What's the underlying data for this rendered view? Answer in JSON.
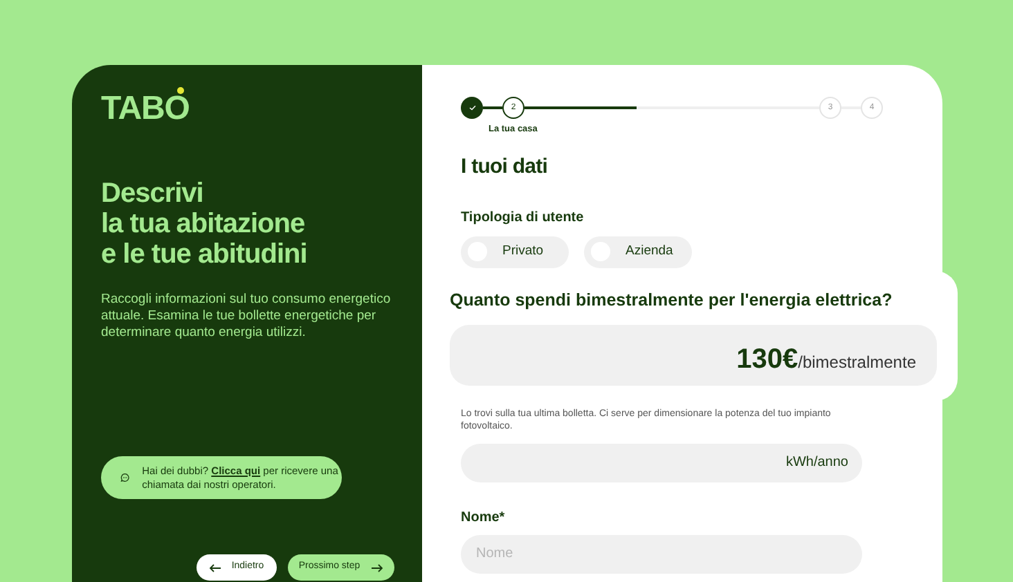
{
  "brand": {
    "logo": "TABO"
  },
  "intro": {
    "title_lines": [
      "Descrivi",
      "la tua abitazione",
      "e le tue abitudini"
    ],
    "text": "Raccogli informazioni sul tuo consumo energetico attuale. Esamina le tue bollette energetiche per determinare quanto energia utilizzi."
  },
  "help": {
    "text_before": "Hai dei dubbi?",
    "link": "Clicca qui",
    "text_after": "per ricevere una chiamata dai nostri operatori."
  },
  "nav": {
    "back": "Indietro",
    "next": "Prossimo step"
  },
  "stepper": {
    "steps": [
      {
        "kind": "done"
      },
      {
        "number": "2",
        "kind": "current",
        "label": "La tua casa"
      },
      {
        "number": "3",
        "kind": "upcoming"
      },
      {
        "number": "4",
        "kind": "upcoming"
      }
    ],
    "level": 0.38
  },
  "form": {
    "title": "I tuoi dati",
    "user_type": {
      "label": "Tipologia di utente",
      "options": [
        {
          "label": "Privato",
          "selected": false
        },
        {
          "label": "Azienda",
          "selected": false
        }
      ]
    },
    "spend": {
      "question": "Quanto spendi bimestralmente per l'energia elettrica?",
      "value": "130€",
      "unit": "/bimestralmente"
    },
    "consumption": {
      "hint": "Lo trovi sulla tua ultima bolletta. Ci serve per dimensionare la potenza del tuo impianto fotovoltaico.",
      "unit": "kWh/anno"
    },
    "name": {
      "label": "Nome*",
      "placeholder": "Nome"
    }
  }
}
